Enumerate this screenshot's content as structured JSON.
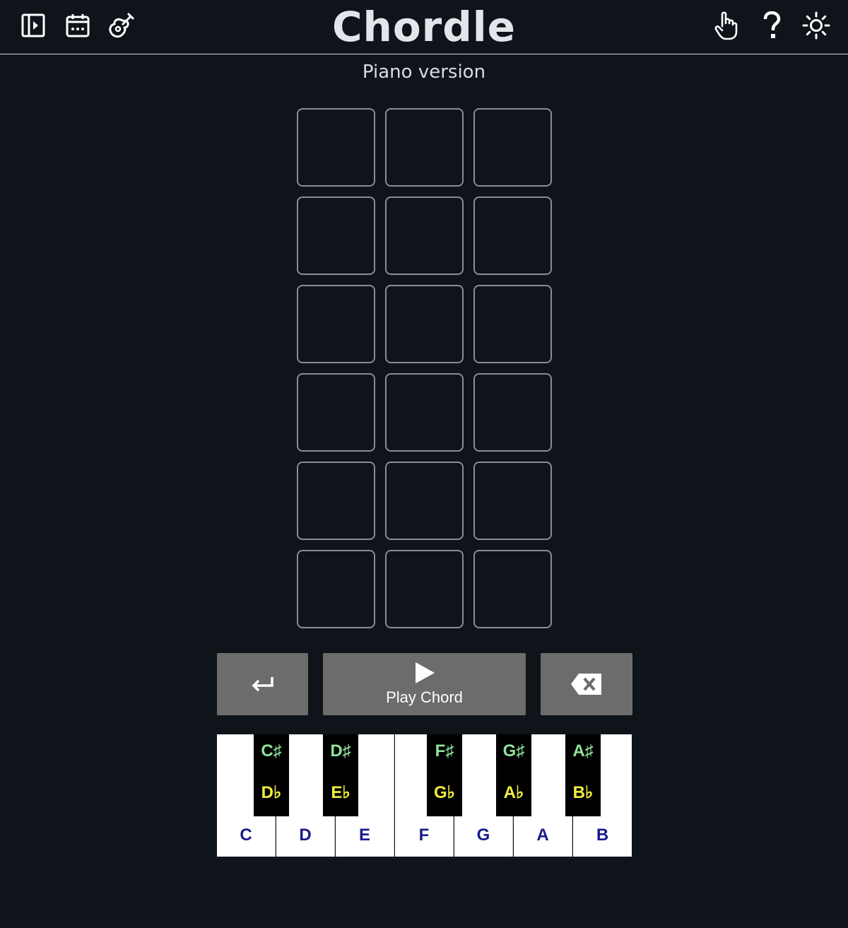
{
  "header": {
    "title": "Chordle",
    "icons": {
      "sidebar": "sidebar-toggle-icon",
      "calendar": "calendar-icon",
      "guitar": "guitar-icon",
      "touch": "hand-pointer-icon",
      "help": "help-icon",
      "theme": "sun-icon"
    }
  },
  "subtitle": "Piano version",
  "board": {
    "rows": 6,
    "columns": 3
  },
  "controls": {
    "enter_icon": "enter-icon",
    "play_label": "Play Chord",
    "backspace_icon": "backspace-icon"
  },
  "piano": {
    "white_keys": [
      "C",
      "D",
      "E",
      "F",
      "G",
      "A",
      "B"
    ],
    "black_keys": [
      {
        "sharp": "C♯",
        "flat": "D♭"
      },
      {
        "sharp": "D♯",
        "flat": "E♭"
      },
      {
        "sharp": "F♯",
        "flat": "G♭"
      },
      {
        "sharp": "G♯",
        "flat": "A♭"
      },
      {
        "sharp": "A♯",
        "flat": "B♭"
      }
    ]
  },
  "colors": {
    "background": "#0f131a",
    "cell_border": "#8a8d92",
    "button": "#6c6c6c",
    "white_key_label": "#1a1a8c",
    "sharp_label": "#8fe39a",
    "flat_label": "#f1ee3a"
  }
}
